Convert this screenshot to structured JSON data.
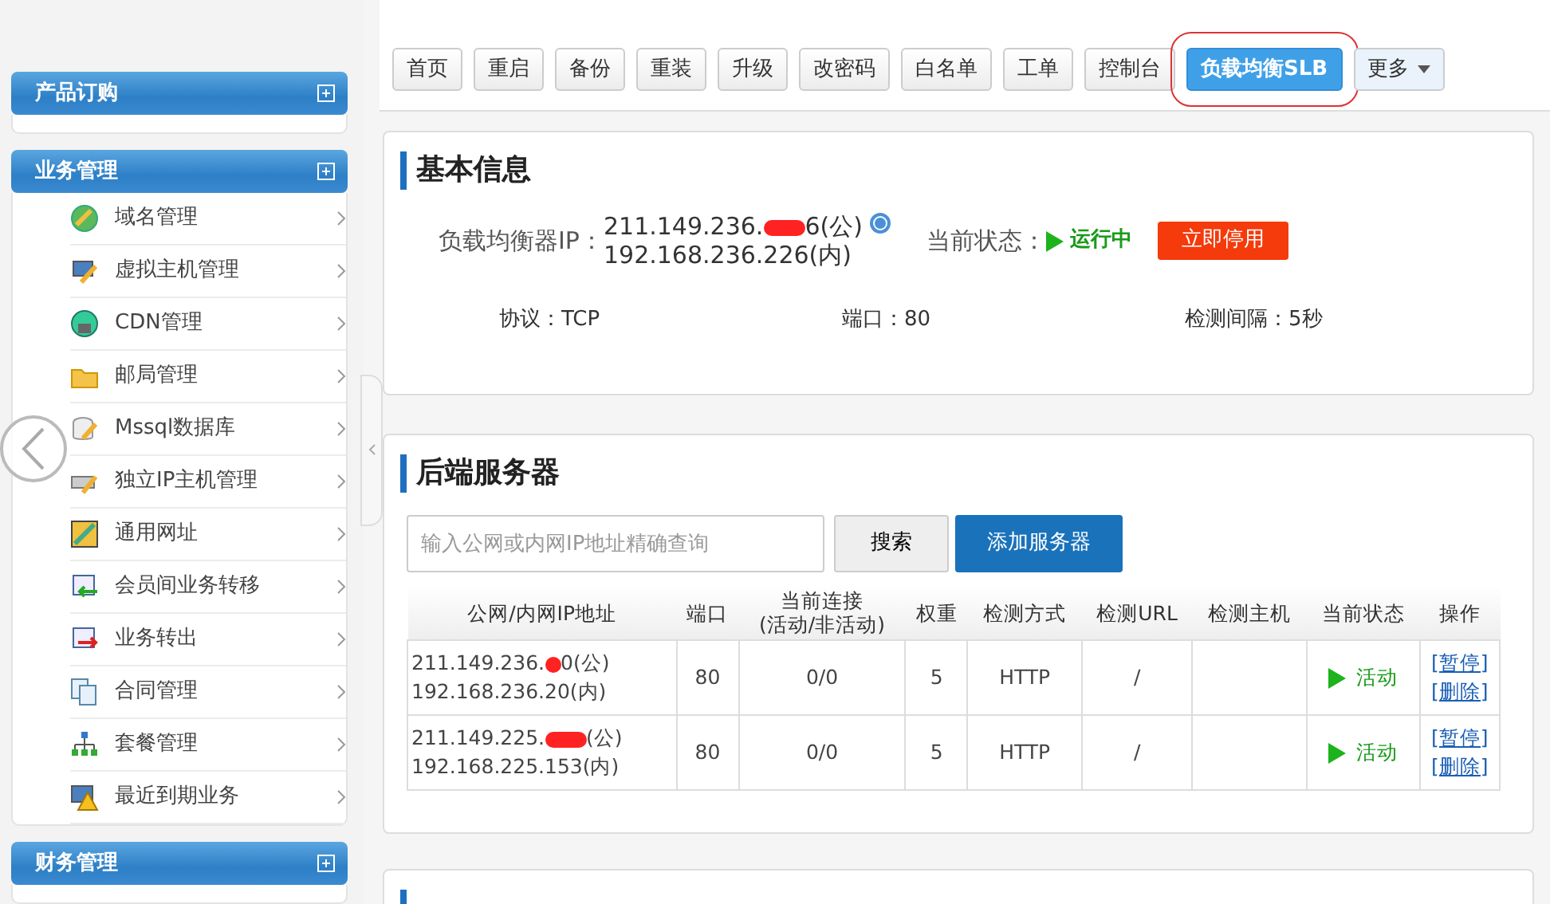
{
  "sidebar": {
    "sections": [
      {
        "title": "产品订购"
      },
      {
        "title": "业务管理",
        "items": [
          {
            "label": "域名管理"
          },
          {
            "label": "虚拟主机管理"
          },
          {
            "label": "CDN管理"
          },
          {
            "label": "邮局管理"
          },
          {
            "label": "Mssql数据库"
          },
          {
            "label": "独立IP主机管理"
          },
          {
            "label": "通用网址"
          },
          {
            "label": "会员间业务转移"
          },
          {
            "label": "业务转出"
          },
          {
            "label": "合同管理"
          },
          {
            "label": "套餐管理"
          },
          {
            "label": "最近到期业务"
          }
        ]
      },
      {
        "title": "财务管理"
      }
    ]
  },
  "toolbar": [
    {
      "label": "首页",
      "selected": false
    },
    {
      "label": "重启",
      "selected": false
    },
    {
      "label": "备份",
      "selected": false
    },
    {
      "label": "重装",
      "selected": false
    },
    {
      "label": "升级",
      "selected": false
    },
    {
      "label": "改密码",
      "selected": false
    },
    {
      "label": "白名单",
      "selected": false
    },
    {
      "label": "工单",
      "selected": false
    },
    {
      "label": "控制台",
      "selected": false
    },
    {
      "label": "负载均衡SLB",
      "selected": true,
      "highlighted": true
    },
    {
      "label": "更多",
      "selected": false,
      "kind": "dropdown"
    }
  ],
  "basic_info": {
    "title": "基本信息",
    "ip_label": "负载均衡器IP：",
    "ip_public": [
      "211.149.236.",
      "6(公)"
    ],
    "ip_private": "192.168.236.226(内)",
    "status_label": "当前状态：",
    "status": "运行中",
    "stop_button": "立即停用",
    "details": [
      "协议：TCP",
      "端口：80",
      "检测间隔：5秒"
    ]
  },
  "backend": {
    "title": "后端服务器",
    "search": {
      "placeholder": "输入公网或内网IP地址精确查询"
    },
    "search_button": "搜索",
    "add_button": "添加服务器",
    "table": {
      "columns": [
        "公网/内网IP地址",
        "端口",
        "当前连接\n(活动/非活动)",
        "权重",
        "检测方式",
        "检测URL",
        "检测主机",
        "当前状态",
        "操作"
      ],
      "rows": [
        {
          "ip_public": [
            "211.149.236.",
            "0(公)"
          ],
          "ip_private": "192.168.236.20(内)",
          "port": "80",
          "connections": "0/0",
          "weight": "5",
          "method": "HTTP",
          "url": "/",
          "status": "活动",
          "actions": [
            "[暂停]",
            "[删除]"
          ]
        },
        {
          "ip_public": [
            "211.149.225.",
            "(公)"
          ],
          "ip_private": "192.168.225.153(内)",
          "port": "80",
          "connections": "0/0",
          "weight": "5",
          "method": "HTTP",
          "url": "/",
          "status": "活动",
          "actions": [
            "[暂停]",
            "[删除]"
          ]
        }
      ]
    }
  }
}
